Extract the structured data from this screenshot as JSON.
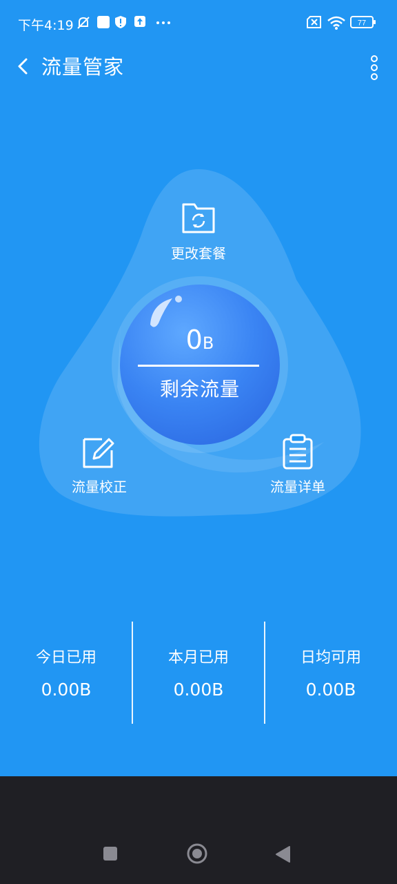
{
  "status_bar": {
    "time": "下午4:19",
    "battery_level": "77",
    "icons": [
      "notifications-off-icon",
      "square-app-icon",
      "shield-icon",
      "upload-icon",
      "more-notifications-icon",
      "no-sim-icon",
      "wifi-icon",
      "battery-icon"
    ]
  },
  "header": {
    "title": "流量管家",
    "back_icon": "back-arrow-icon",
    "menu_icon": "more-vertical-icon"
  },
  "hero": {
    "remaining_value": "0",
    "remaining_unit": "B",
    "remaining_label": "剩余流量",
    "actions": [
      {
        "label": "更改套餐",
        "icon": "folder-refresh-icon"
      },
      {
        "label": "流量校正",
        "icon": "edit-icon"
      },
      {
        "label": "流量详单",
        "icon": "clipboard-icon"
      }
    ]
  },
  "stats": [
    {
      "label": "今日已用",
      "value": "0.00B"
    },
    {
      "label": "本月已用",
      "value": "0.00B"
    },
    {
      "label": "日均可用",
      "value": "0.00B"
    }
  ],
  "nav": {
    "icons": [
      "recent-apps-icon",
      "home-icon",
      "back-icon"
    ]
  },
  "colors": {
    "primary": "#2196f3",
    "ball": "#3f86f2",
    "nav_background": "#1f1f24"
  }
}
